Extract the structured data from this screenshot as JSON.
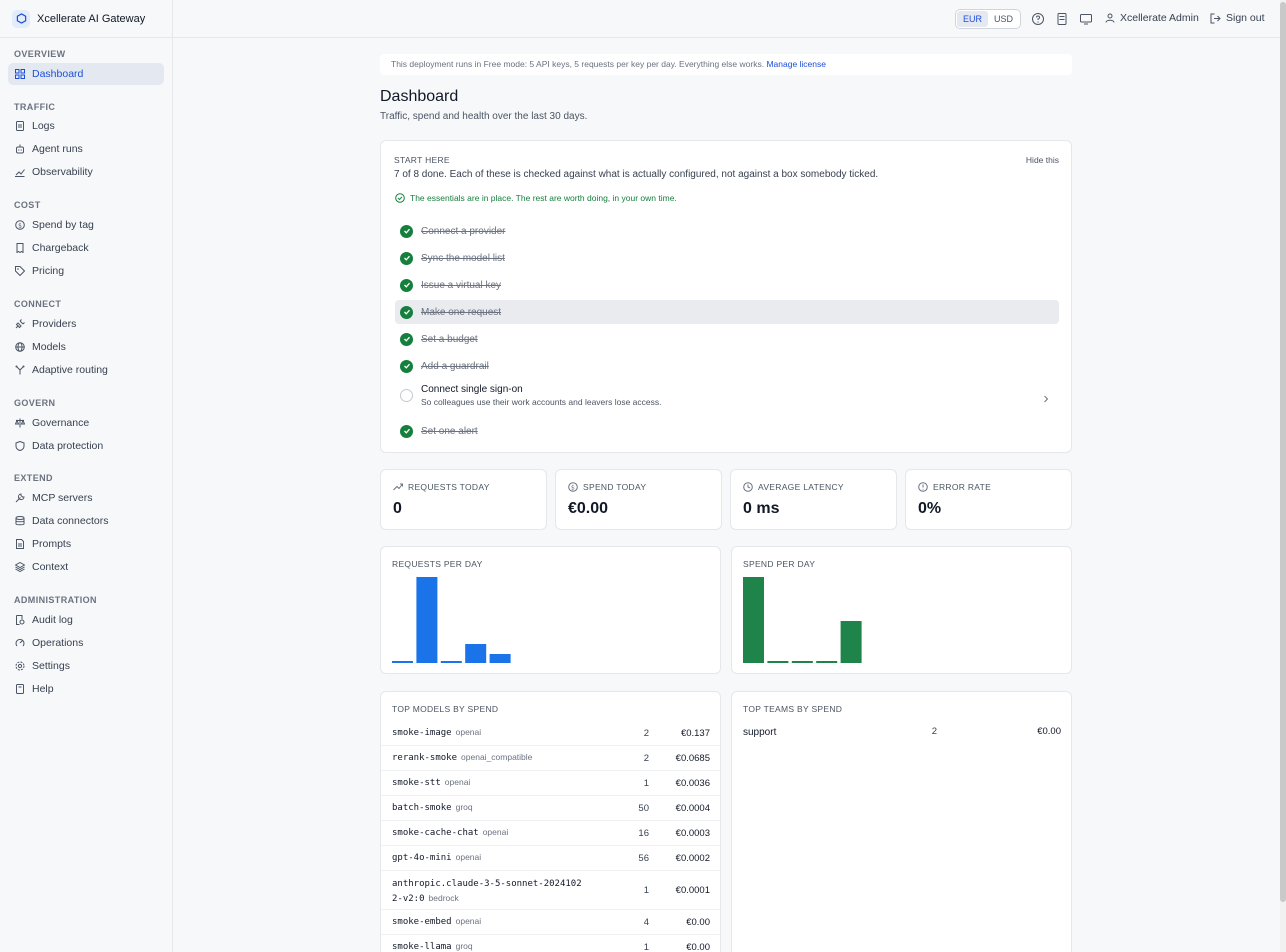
{
  "app": {
    "name": "Xcellerate AI Gateway"
  },
  "sidebar": {
    "sections": [
      {
        "title": "OVERVIEW",
        "items": [
          {
            "label": "Dashboard",
            "icon": "dashboard-icon",
            "active": true
          }
        ]
      },
      {
        "title": "TRAFFIC",
        "items": [
          {
            "label": "Logs",
            "icon": "document-icon"
          },
          {
            "label": "Agent runs",
            "icon": "bot-icon"
          },
          {
            "label": "Observability",
            "icon": "chart-line-icon"
          }
        ]
      },
      {
        "title": "COST",
        "items": [
          {
            "label": "Spend by tag",
            "icon": "coin-icon"
          },
          {
            "label": "Chargeback",
            "icon": "receipt-icon"
          },
          {
            "label": "Pricing",
            "icon": "tag-icon"
          }
        ]
      },
      {
        "title": "CONNECT",
        "items": [
          {
            "label": "Providers",
            "icon": "plug-icon"
          },
          {
            "label": "Models",
            "icon": "globe-icon"
          },
          {
            "label": "Adaptive routing",
            "icon": "route-icon"
          }
        ]
      },
      {
        "title": "GOVERN",
        "items": [
          {
            "label": "Governance",
            "icon": "scale-icon"
          },
          {
            "label": "Data protection",
            "icon": "shield-icon"
          }
        ]
      },
      {
        "title": "EXTEND",
        "items": [
          {
            "label": "MCP servers",
            "icon": "wrench-icon"
          },
          {
            "label": "Data connectors",
            "icon": "database-icon"
          },
          {
            "label": "Prompts",
            "icon": "file-text-icon"
          },
          {
            "label": "Context",
            "icon": "layers-icon"
          }
        ]
      },
      {
        "title": "ADMINISTRATION",
        "items": [
          {
            "label": "Audit log",
            "icon": "audit-icon"
          },
          {
            "label": "Operations",
            "icon": "operations-icon"
          },
          {
            "label": "Settings",
            "icon": "gear-icon"
          },
          {
            "label": "Help",
            "icon": "book-icon"
          }
        ]
      }
    ]
  },
  "topbar": {
    "currency": {
      "options": [
        "EUR",
        "USD"
      ],
      "selected": "EUR"
    },
    "user": "Xcellerate Admin",
    "signout": "Sign out"
  },
  "banner": {
    "text": "This deployment runs in Free mode: 5 API keys, 5 requests per key per day. Everything else works.",
    "link": "Manage license"
  },
  "page": {
    "title": "Dashboard",
    "subtitle": "Traffic, spend and health over the last 30 days."
  },
  "start": {
    "eyebrow": "START HERE",
    "hide": "Hide this",
    "desc": "7 of 8 done. Each of these is checked against what is actually configured, not against a box somebody ticked.",
    "ok": "The essentials are in place. The rest are worth doing, in your own time.",
    "steps": [
      {
        "label": "Connect a provider",
        "done": true
      },
      {
        "label": "Sync the model list",
        "done": true
      },
      {
        "label": "Issue a virtual key",
        "done": true
      },
      {
        "label": "Make one request",
        "done": true
      },
      {
        "label": "Set a budget",
        "done": true
      },
      {
        "label": "Add a guardrail",
        "done": true
      },
      {
        "label": "Connect single sign-on",
        "sub": "So colleagues use their work accounts and leavers lose access.",
        "done": false
      },
      {
        "label": "Set one alert",
        "done": true
      }
    ]
  },
  "stats": [
    {
      "label": "REQUESTS TODAY",
      "value": "0",
      "icon": "trending-icon"
    },
    {
      "label": "SPEND TODAY",
      "value": "€0.00",
      "icon": "coin-icon"
    },
    {
      "label": "AVERAGE LATENCY",
      "value": "0 ms",
      "icon": "clock-icon"
    },
    {
      "label": "ERROR RATE",
      "value": "0%",
      "icon": "alert-icon"
    }
  ],
  "chart_data": [
    {
      "type": "bar",
      "title": "REQUESTS PER DAY",
      "color": "#1a73e8",
      "values": [
        2,
        86,
        2,
        19,
        9
      ]
    },
    {
      "type": "bar",
      "title": "SPEND PER DAY",
      "color": "#1e8449",
      "values": [
        0.86,
        0.02,
        0.02,
        0.02,
        0.42
      ]
    }
  ],
  "top_models": {
    "title": "TOP MODELS BY SPEND",
    "rows": [
      {
        "name": "smoke-image",
        "provider": "openai",
        "count": "2",
        "cost": "€0.137"
      },
      {
        "name": "rerank-smoke",
        "provider": "openai_compatible",
        "count": "2",
        "cost": "€0.0685"
      },
      {
        "name": "smoke-stt",
        "provider": "openai",
        "count": "1",
        "cost": "€0.0036"
      },
      {
        "name": "batch-smoke",
        "provider": "groq",
        "count": "50",
        "cost": "€0.0004"
      },
      {
        "name": "smoke-cache-chat",
        "provider": "openai",
        "count": "16",
        "cost": "€0.0003"
      },
      {
        "name": "gpt-4o-mini",
        "provider": "openai",
        "count": "56",
        "cost": "€0.0002"
      },
      {
        "name": "anthropic.claude-3-5-sonnet-20241022-v2:0",
        "provider": "bedrock",
        "count": "1",
        "cost": "€0.0001"
      },
      {
        "name": "smoke-embed",
        "provider": "openai",
        "count": "4",
        "cost": "€0.00"
      },
      {
        "name": "smoke-llama",
        "provider": "groq",
        "count": "1",
        "cost": "€0.00"
      }
    ]
  },
  "top_teams": {
    "title": "TOP TEAMS BY SPEND",
    "rows": [
      {
        "name": "support",
        "count": "2",
        "cost": "€0.00"
      }
    ]
  }
}
